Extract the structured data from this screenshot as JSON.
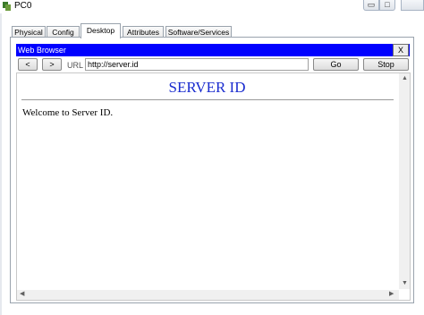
{
  "window": {
    "title": "PC0",
    "minimize_glyph": "▭",
    "maximize_glyph": "□",
    "close_glyph": ""
  },
  "tabs": [
    {
      "label": "Physical"
    },
    {
      "label": "Config"
    },
    {
      "label": "Desktop"
    },
    {
      "label": "Attributes"
    },
    {
      "label": "Software/Services"
    }
  ],
  "active_tab": "Desktop",
  "browser": {
    "title": "Web Browser",
    "close_label": "X",
    "back_label": "<",
    "forward_label": ">",
    "url_label": "URL",
    "url_value": "http://server.id",
    "go_label": "Go",
    "stop_label": "Stop"
  },
  "page": {
    "heading": "SERVER ID",
    "body_text": "Welcome to Server ID."
  },
  "colors": {
    "browser_title_bar": "#0000ff",
    "heading_text": "#1a2ccf"
  }
}
